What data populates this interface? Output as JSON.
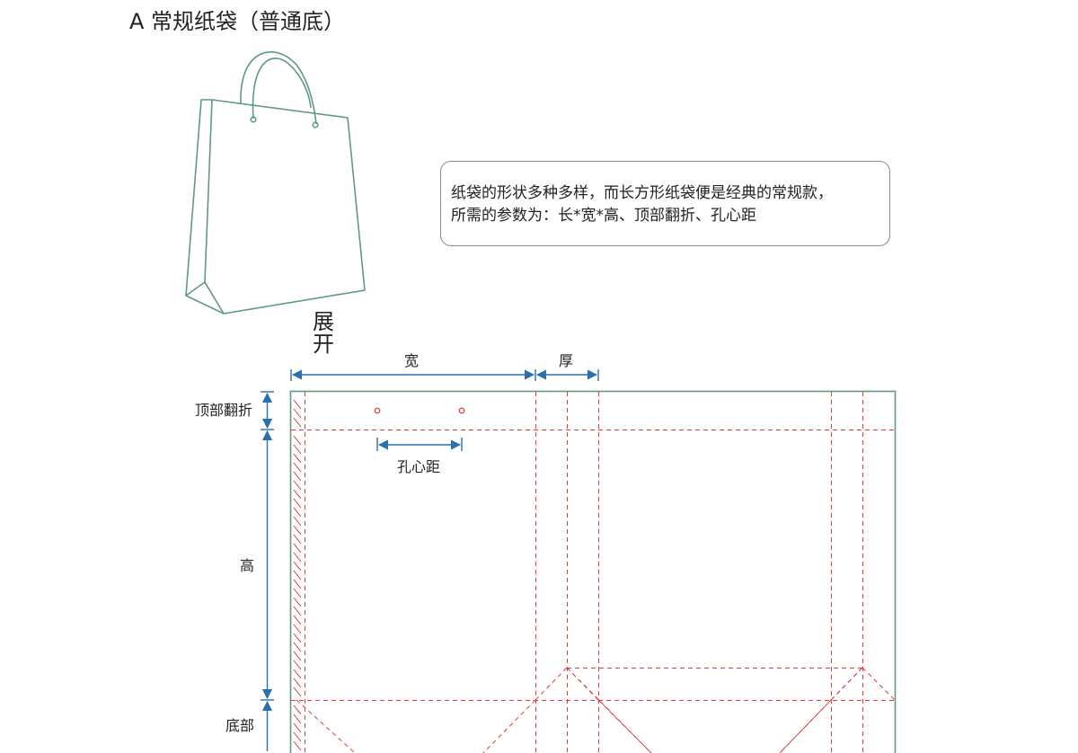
{
  "title": "A 常规纸袋（普通底）",
  "info": {
    "line1": "纸袋的形状多种多样，而长方形纸袋便是经典的常规款，",
    "line2": "所需的参数为：长*宽*高、顶部翻折、孔心距"
  },
  "unfold_label": "展开",
  "dimensions": {
    "width": "宽",
    "thickness": "厚",
    "top_fold": "顶部翻折",
    "hole_distance": "孔心距",
    "height": "高",
    "bottom": "底部"
  },
  "colors": {
    "outline": "#5f9a80",
    "fold_line": "#e03a3a",
    "dimension": "#2a6fae",
    "text": "#222222"
  }
}
